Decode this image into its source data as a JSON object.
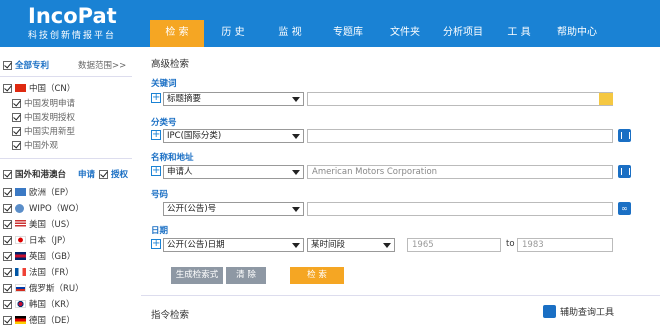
{
  "logo": {
    "main": "IncoPat",
    "sub": "科技创新情报平台"
  },
  "nav": [
    "检 索",
    "历 史",
    "监 视",
    "专题库",
    "文件夹",
    "分析项目",
    "工 具",
    "帮助中心"
  ],
  "sidebar": {
    "all_patents": "全部专利",
    "data_range": "数据范围>>",
    "china": "中国（CN）",
    "china_items": [
      "中国发明申请",
      "中国发明授权",
      "中国实用新型",
      "中国外观"
    ],
    "foreign": "国外和港澳台",
    "apply": "申请",
    "grant": "授权",
    "countries": [
      "欧洲（EP）",
      "WIPO（WO）",
      "美国（US）",
      "日本（JP）",
      "英国（GB）",
      "法国（FR）",
      "俄罗斯（RU）",
      "韩国（KR）",
      "德国（DE）"
    ]
  },
  "main": {
    "title": "高级检索",
    "keyword_label": "关键词",
    "keyword_field": "标题摘要",
    "class_label": "分类号",
    "class_field": "IPC(国际分类)",
    "name_label": "名称和地址",
    "name_field": "申请人",
    "name_placeholder": "American Motors Corporation",
    "number_label": "号码",
    "number_field": "公开(公告)号",
    "date_label": "日期",
    "date_field": "公开(公告)日期",
    "date_range": "某时间段",
    "date_from": "1965",
    "date_to_label": "to",
    "date_to": "1983",
    "gen_button": "生成检索式",
    "clear_button": "清 除",
    "search_button": "检 索",
    "command_label": "指令检索",
    "assist_label": "辅助查询工具"
  },
  "colors": {
    "header": "#1a82d4",
    "accent": "#f5a623",
    "link": "#1a6fc4"
  }
}
